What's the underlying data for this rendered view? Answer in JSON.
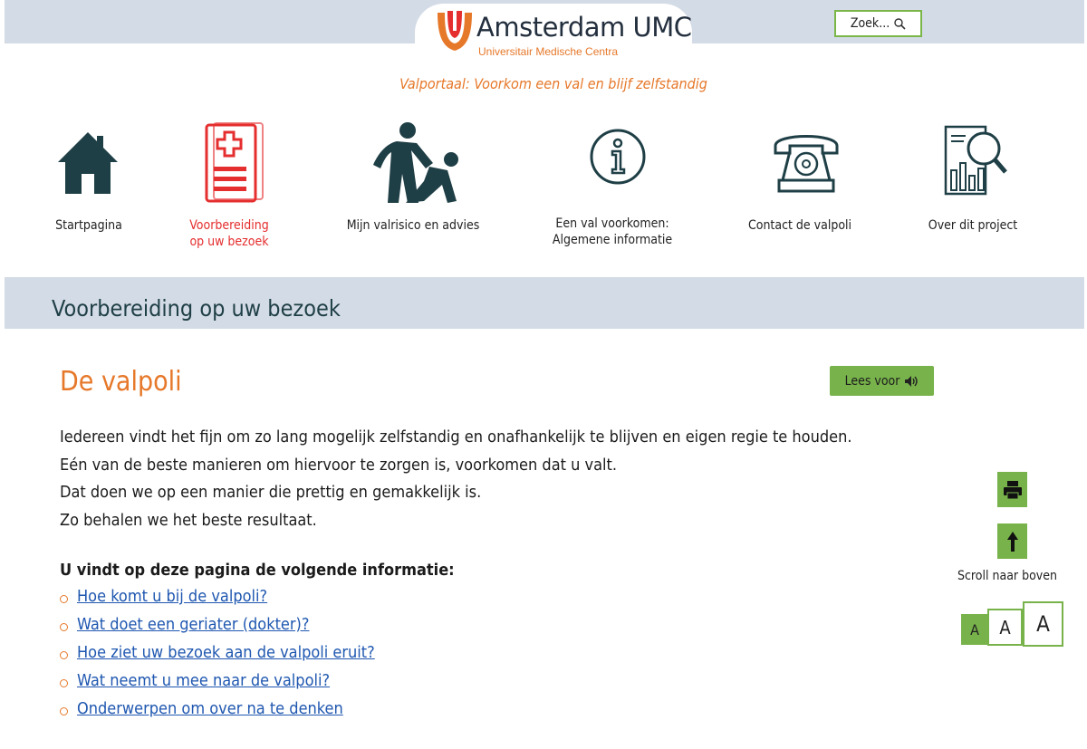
{
  "header": {
    "logo_title": "Amsterdam UMC",
    "logo_subtitle": "Universitair Medische Centra",
    "search_label": "Zoek...",
    "search_icon": "magnifier-icon",
    "tagline": "Valportaal: Voorkom een val en blijf zelfstandig"
  },
  "nav": {
    "items": [
      {
        "label_1": "Startpagina",
        "label_2": "",
        "icon": "home-icon",
        "active": false
      },
      {
        "label_1": "Voorbereiding",
        "label_2": "op uw bezoek",
        "icon": "medical-document-icon",
        "active": true
      },
      {
        "label_1": "Mijn valrisico en advies",
        "label_2": "",
        "icon": "fall-assistance-icon",
        "active": false
      },
      {
        "label_1": "Een val voorkomen:",
        "label_2": "Algemene informatie",
        "icon": "info-icon",
        "active": false
      },
      {
        "label_1": "Contact de valpoli",
        "label_2": "",
        "icon": "telephone-icon",
        "active": false
      },
      {
        "label_1": "Over dit project",
        "label_2": "",
        "icon": "report-search-icon",
        "active": false
      }
    ]
  },
  "section": {
    "title": "Voorbereiding op uw bezoek"
  },
  "content": {
    "heading": "De valpoli",
    "read_aloud_label": "Lees voor",
    "paragraphs": [
      "Iedereen vindt het fijn om zo lang mogelijk zelfstandig en onafhankelijk te blijven en eigen regie te houden.",
      "Eén van de beste manieren om hiervoor te zorgen is, voorkomen dat u valt.",
      "Dat doen we op een manier die prettig en gemakkelijk is.",
      "Zo behalen we het beste resultaat."
    ],
    "toc_title": "U vindt op deze pagina de volgende informatie:",
    "toc_links": [
      "Hoe komt u bij de valpoli?",
      "Wat doet een geriater (dokter)?",
      "Hoe ziet uw bezoek aan de valpoli eruit?",
      "Wat neemt u mee naar de valpoli?",
      "Onderwerpen om over na te denken"
    ]
  },
  "sidebar": {
    "print_icon": "printer-icon",
    "scroll_icon": "arrow-up-icon",
    "scroll_label": "Scroll naar boven",
    "font_sizes": [
      "A",
      "A",
      "A"
    ],
    "selected_font_size": 0
  },
  "colors": {
    "accent_orange": "#e6782a",
    "accent_green": "#77b24a",
    "active_red": "#e52e2e",
    "header_band": "#d3dbe6",
    "link_blue": "#1f57b0",
    "icon_teal": "#1f3f46"
  }
}
